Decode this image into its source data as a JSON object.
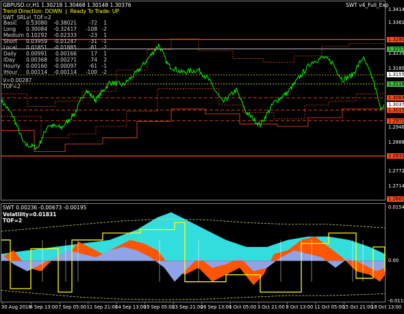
{
  "header": {
    "symbol_line": "GBPUSD.cr,H1  1.30218 1.30468 1.30148 1.30376",
    "trend_prefix": "Trend Direction:",
    "trend_value": "DOWN",
    "ready_prefix": "Ready To Trade:",
    "ready_value": "UP",
    "indicator_name": "SWT_SRLvl_TOF=2",
    "top_right_label": "SWT v4_Full_Exp",
    "v_line": "V=0.00287",
    "tof_line": "TOF=2"
  },
  "stats": [
    {
      "name": "Basic",
      "v1": "0.53080",
      "v2": "-0.38021",
      "v3": "-72",
      "v4": "1"
    },
    {
      "name": "Long",
      "v1": "0.30084",
      "v2": "-0.32417",
      "v3": "-108",
      "v4": "-2"
    },
    {
      "name": "Medium",
      "v1": "0.10292",
      "v2": "-0.02333",
      "v3": "-23",
      "v4": "1"
    },
    {
      "name": "Short",
      "v1": "0.03959",
      "v2": "-0.01247",
      "v3": "-31",
      "v4": "-1"
    },
    {
      "name": "Local",
      "v1": "0.01851",
      "v2": "-0.01885",
      "v3": "-81",
      "v4": "-2"
    },
    {
      "name": "Daily",
      "v1": "0.00991",
      "v2": "0.00166",
      "v3": "17",
      "v4": "1"
    },
    {
      "name": "IDay",
      "v1": "0.00368",
      "v2": "0.00271",
      "v3": "74",
      "v4": "2"
    },
    {
      "name": "Hourly",
      "v1": "0.00160",
      "v2": "-0.00097",
      "v3": "-61",
      "v4": "-1"
    },
    {
      "name": "IHour",
      "v1": "0.00114",
      "v2": "-0.00114",
      "v3": "-100",
      "v4": "-2"
    }
  ],
  "price_axis": {
    "ticks": [
      "1.34145",
      "1.33615",
      "1.32905",
      "1.32398",
      "1.31805",
      "1.31189",
      "1.30376",
      "1.29465",
      "1.28880",
      "1.28327",
      "1.27720",
      "1.27145",
      "1.26615"
    ],
    "boxed": [
      {
        "label": "1.32959",
        "color": "#ff4a1a"
      },
      {
        "label": "1.32578",
        "color": "#3dbb3d"
      },
      {
        "label": "1.31551",
        "color": "#ffffff"
      },
      {
        "label": "1.31189",
        "color": "#3dbb3d"
      },
      {
        "label": "1.30640",
        "color": "#ff4a1a"
      },
      {
        "label": "1.30376",
        "color": "#ffffff"
      },
      {
        "label": "1.30150",
        "color": "#ff4a1a"
      },
      {
        "label": "1.29725",
        "color": "#ff4a1a"
      },
      {
        "label": "1.28327",
        "color": "#ff4a1a"
      },
      {
        "label": "1.26615",
        "color": "#ff4a1a"
      }
    ]
  },
  "sub": {
    "title": "SWT 0.00236 -0.00673 -0.00195",
    "volatility": "Volatility=0.01831",
    "tof": "TOF=2",
    "axis": [
      "0.01541",
      "0.00",
      "-0.01156"
    ]
  },
  "time_axis": [
    "30 Aug 2018",
    "4 Sep 13:00",
    "7 Sep 05:00",
    "11 Sep 21:00",
    "14 Sep 13:00",
    "19 Sep 05:00",
    "23 Sep 21:00",
    "26 Sep 13:00",
    "1 Oct 05:00",
    "3 Oct 21:00",
    "8 Oct 13:00",
    "11 Oct 05:00",
    "15 Oct 21:00",
    "18 Oct 13:00"
  ],
  "colors": {
    "price": "#00ff00",
    "resistance": "#ff4a1a",
    "support": "#ffffff",
    "yellow": "#ffff00",
    "cyan": "#33dddd",
    "orange": "#ff5500",
    "blue": "#8fa4e8"
  }
}
